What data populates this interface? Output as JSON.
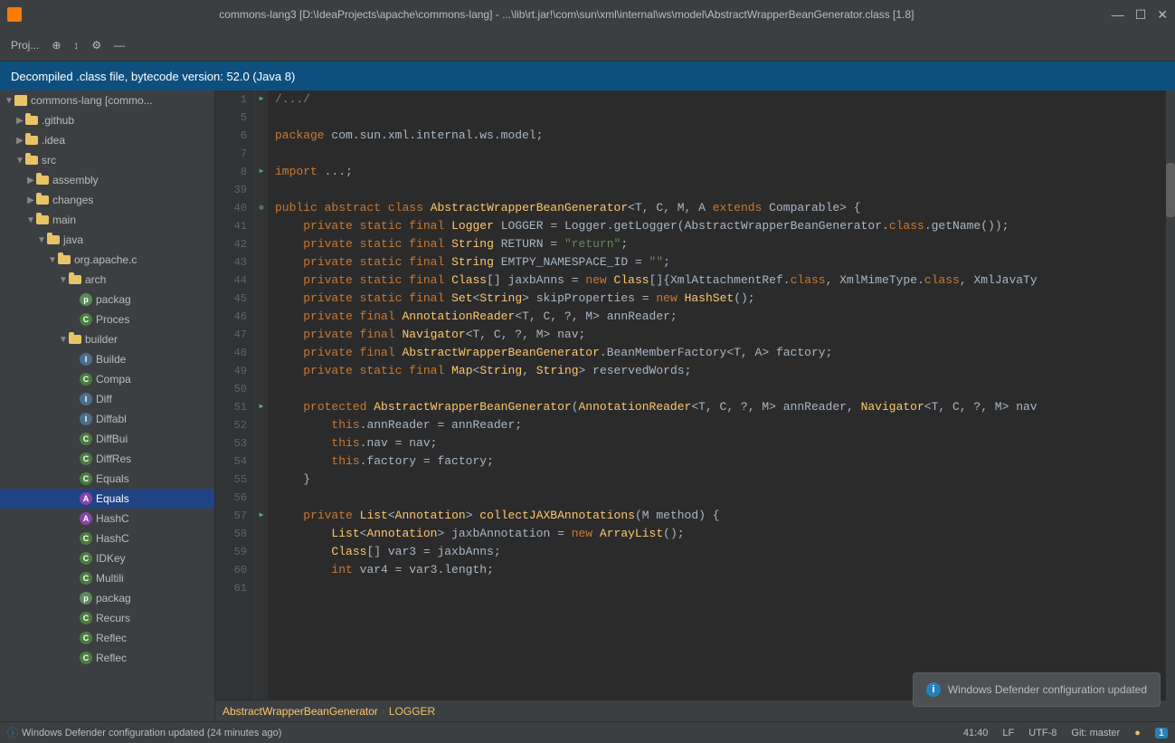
{
  "titleBar": {
    "icon": "intellij-icon",
    "title": "commons-lang3 [D:\\IdeaProjects\\apache\\commons-lang] - ...\\lib\\rt.jar!\\com\\sun\\xml\\internal\\ws\\model\\AbstractWrapperBeanGenerator.class [1.8]",
    "controls": [
      "—",
      "☐",
      "✕"
    ]
  },
  "toolbar": {
    "projectLabel": "Proj...",
    "buttons": [
      "⊕",
      "↕",
      "⚙",
      "—"
    ]
  },
  "decompiledBanner": {
    "text": "Decompiled .class file, bytecode version: 52.0 (Java 8)"
  },
  "sidebar": {
    "items": [
      {
        "id": "commons-lang",
        "label": "commons-lang [commo...",
        "indent": 0,
        "type": "root",
        "expanded": true
      },
      {
        "id": "github",
        "label": ".github",
        "indent": 1,
        "type": "folder",
        "expanded": false
      },
      {
        "id": "idea",
        "label": ".idea",
        "indent": 1,
        "type": "folder",
        "expanded": false
      },
      {
        "id": "src",
        "label": "src",
        "indent": 1,
        "type": "folder",
        "expanded": true
      },
      {
        "id": "assembly",
        "label": "assembly",
        "indent": 2,
        "type": "folder",
        "expanded": false
      },
      {
        "id": "changes",
        "label": "changes",
        "indent": 2,
        "type": "folder",
        "expanded": false
      },
      {
        "id": "main",
        "label": "main",
        "indent": 2,
        "type": "folder",
        "expanded": true
      },
      {
        "id": "java",
        "label": "java",
        "indent": 3,
        "type": "folder",
        "expanded": true
      },
      {
        "id": "orgapache",
        "label": "org.apache.c",
        "indent": 4,
        "type": "folder",
        "expanded": true
      },
      {
        "id": "arch",
        "label": "arch",
        "indent": 5,
        "type": "folder",
        "expanded": true
      },
      {
        "id": "package",
        "label": "packag",
        "indent": 6,
        "type": "file-pkg",
        "expanded": false
      },
      {
        "id": "process",
        "label": "Proces",
        "indent": 6,
        "type": "file-C",
        "expanded": false
      },
      {
        "id": "builder",
        "label": "builder",
        "indent": 5,
        "type": "folder",
        "expanded": true
      },
      {
        "id": "Builder",
        "label": "Builde",
        "indent": 6,
        "type": "file-I",
        "expanded": false
      },
      {
        "id": "Compa",
        "label": "Compa",
        "indent": 6,
        "type": "file-C",
        "expanded": false
      },
      {
        "id": "Diff",
        "label": "Diff",
        "indent": 6,
        "type": "file-I",
        "expanded": false
      },
      {
        "id": "Diffabl",
        "label": "Diffabl",
        "indent": 6,
        "type": "file-I",
        "expanded": false
      },
      {
        "id": "DiffBui",
        "label": "DiffBui",
        "indent": 6,
        "type": "file-C",
        "expanded": false
      },
      {
        "id": "DiffRes",
        "label": "DiffRes",
        "indent": 6,
        "type": "file-C",
        "expanded": false
      },
      {
        "id": "Equals1",
        "label": "Equals",
        "indent": 6,
        "type": "file-C",
        "expanded": false
      },
      {
        "id": "Equals2",
        "label": "Equals",
        "indent": 6,
        "type": "file-A",
        "expanded": false,
        "selected": true
      },
      {
        "id": "HashC1",
        "label": "HashC",
        "indent": 6,
        "type": "file-A",
        "expanded": false
      },
      {
        "id": "HashC2",
        "label": "HashC",
        "indent": 6,
        "type": "file-C",
        "expanded": false
      },
      {
        "id": "IDKey",
        "label": "IDKey",
        "indent": 6,
        "type": "file-C",
        "expanded": false
      },
      {
        "id": "Multili",
        "label": "Multili",
        "indent": 6,
        "type": "file-C",
        "expanded": false
      },
      {
        "id": "package2",
        "label": "packag",
        "indent": 6,
        "type": "file-pkg",
        "expanded": false
      },
      {
        "id": "Recurs",
        "label": "Recurs",
        "indent": 6,
        "type": "file-C",
        "expanded": false
      },
      {
        "id": "Reflec1",
        "label": "Reflec",
        "indent": 6,
        "type": "file-C",
        "expanded": false
      },
      {
        "id": "Reflec2",
        "label": "Reflec",
        "indent": 6,
        "type": "file-C",
        "expanded": false
      }
    ]
  },
  "code": {
    "lines": [
      {
        "num": 1,
        "gutter": "▶",
        "content": "cmt",
        "text": "/.../",
        "indent": 4
      },
      {
        "num": 5,
        "gutter": "",
        "content": "plain",
        "text": ""
      },
      {
        "num": 6,
        "gutter": "",
        "content": "pkg",
        "text": "package com.sun.xml.internal.ws.model;"
      },
      {
        "num": 7,
        "gutter": "",
        "content": "plain",
        "text": ""
      },
      {
        "num": 8,
        "gutter": "▶",
        "content": "mixed",
        "text": "import ...;"
      },
      {
        "num": 39,
        "gutter": "",
        "content": "plain",
        "text": ""
      },
      {
        "num": 40,
        "gutter": "⊕",
        "content": "class-decl",
        "text": "public abstract class AbstractWrapperBeanGenerator<T, C, M, A extends Comparable> {"
      },
      {
        "num": 41,
        "gutter": "",
        "content": "field",
        "text": "    private static final Logger LOGGER = Logger.getLogger(AbstractWrapperBeanGenerator.class.getName());"
      },
      {
        "num": 42,
        "gutter": "",
        "content": "field",
        "text": "    private static final String RETURN = \"return\";"
      },
      {
        "num": 43,
        "gutter": "",
        "content": "field",
        "text": "    private static final String EMTPY_NAMESPACE_ID = \"\";"
      },
      {
        "num": 44,
        "gutter": "",
        "content": "field",
        "text": "    private static final Class[] jaxbAnns = new Class[]{XmlAttachmentRef.class, XmlMimeType.class, XmlJavaTy"
      },
      {
        "num": 45,
        "gutter": "",
        "content": "field",
        "text": "    private static final Set<String> skipProperties = new HashSet();"
      },
      {
        "num": 46,
        "gutter": "",
        "content": "field",
        "text": "    private final AnnotationReader<T, C, ?, M> annReader;"
      },
      {
        "num": 47,
        "gutter": "",
        "content": "field",
        "text": "    private final Navigator<T, C, ?, M> nav;"
      },
      {
        "num": 48,
        "gutter": "",
        "content": "field",
        "text": "    private final AbstractWrapperBeanGenerator.BeanMemberFactory<T, A> factory;"
      },
      {
        "num": 49,
        "gutter": "",
        "content": "field",
        "text": "    private static final Map<String, String> reservedWords;"
      },
      {
        "num": 50,
        "gutter": "",
        "content": "plain",
        "text": ""
      },
      {
        "num": 51,
        "gutter": "▶",
        "content": "constructor",
        "text": "    protected AbstractWrapperBeanGenerator(AnnotationReader<T, C, ?, M> annReader, Navigator<T, C, ?, M> nav"
      },
      {
        "num": 52,
        "gutter": "",
        "content": "body",
        "text": "        this.annReader = annReader;"
      },
      {
        "num": 53,
        "gutter": "",
        "content": "body",
        "text": "        this.nav = nav;"
      },
      {
        "num": 54,
        "gutter": "",
        "content": "body",
        "text": "        this.factory = factory;"
      },
      {
        "num": 55,
        "gutter": "",
        "content": "plain",
        "text": "    }"
      },
      {
        "num": 56,
        "gutter": "",
        "content": "plain",
        "text": ""
      },
      {
        "num": 57,
        "gutter": "▶",
        "content": "method",
        "text": "    private List<Annotation> collectJAXBAnnotations(M method) {"
      },
      {
        "num": 58,
        "gutter": "",
        "content": "body",
        "text": "        List<Annotation> jaxbAnnotation = new ArrayList();"
      },
      {
        "num": 59,
        "gutter": "",
        "content": "body",
        "text": "        Class[] var3 = jaxbAnns;"
      },
      {
        "num": 60,
        "gutter": "",
        "content": "body",
        "text": "        int var4 = var3.length;"
      },
      {
        "num": 61,
        "gutter": "",
        "content": "body",
        "text": ""
      }
    ]
  },
  "breadcrumb": {
    "file": "AbstractWrapperBeanGenerator",
    "separator": "›",
    "member": "LOGGER"
  },
  "statusBar": {
    "message": "Windows Defender configuration updated (24 minutes ago)",
    "position": "41:40",
    "lineEnding": "LF",
    "encoding": "UTF-8",
    "vcs": "Git: master",
    "indicator": "●",
    "count": "1"
  },
  "toast": {
    "icon": "i",
    "message": "Windows Defender configuration updated"
  }
}
